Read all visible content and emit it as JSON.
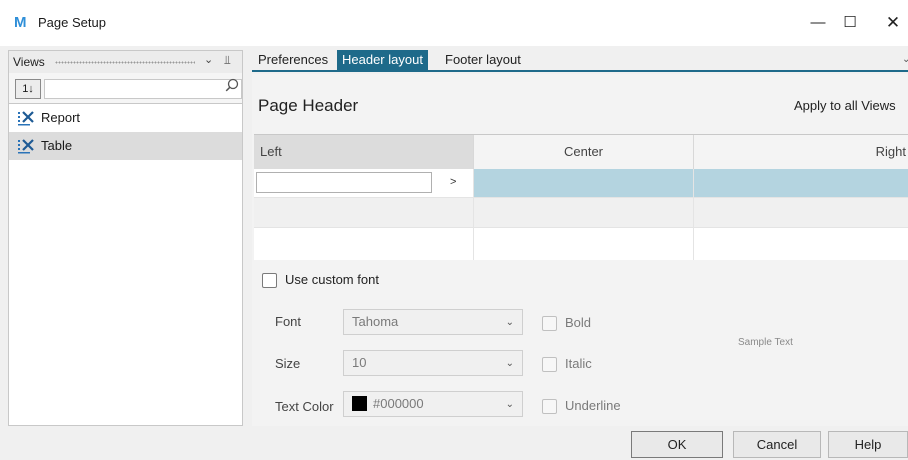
{
  "window": {
    "title": "Page Setup",
    "app_icon_glyph": "M",
    "app_icon_color": "#2f8fd8"
  },
  "views_panel": {
    "title": "Views",
    "sort_button_label": "1↓",
    "search_value": "",
    "items": [
      {
        "label": "Report",
        "icon": "grid-view-icon",
        "selected": false
      },
      {
        "label": "Table",
        "icon": "grid-view-icon",
        "selected": true
      }
    ]
  },
  "tabs": [
    {
      "label": "Preferences",
      "active": false
    },
    {
      "label": "Header layout",
      "active": true
    },
    {
      "label": "Footer layout",
      "active": false
    }
  ],
  "header": {
    "title": "Page Header",
    "apply_link": "Apply to all Views",
    "columns": [
      "Left",
      "Center",
      "Right"
    ],
    "left_value": "",
    "expand_glyph": ">"
  },
  "font": {
    "custom_font_label": "Use custom font",
    "font_label": "Font",
    "font_value": "Tahoma",
    "size_label": "Size",
    "size_value": "10",
    "color_label": "Text Color",
    "color_value": "#000000",
    "bold_label": "Bold",
    "italic_label": "Italic",
    "underline_label": "Underline",
    "sample_text": "Sample Text"
  },
  "buttons": {
    "ok": "OK",
    "cancel": "Cancel",
    "help": "Help"
  },
  "colors": {
    "accent": "#1e6a8a",
    "selection": "#b4d4e0"
  }
}
